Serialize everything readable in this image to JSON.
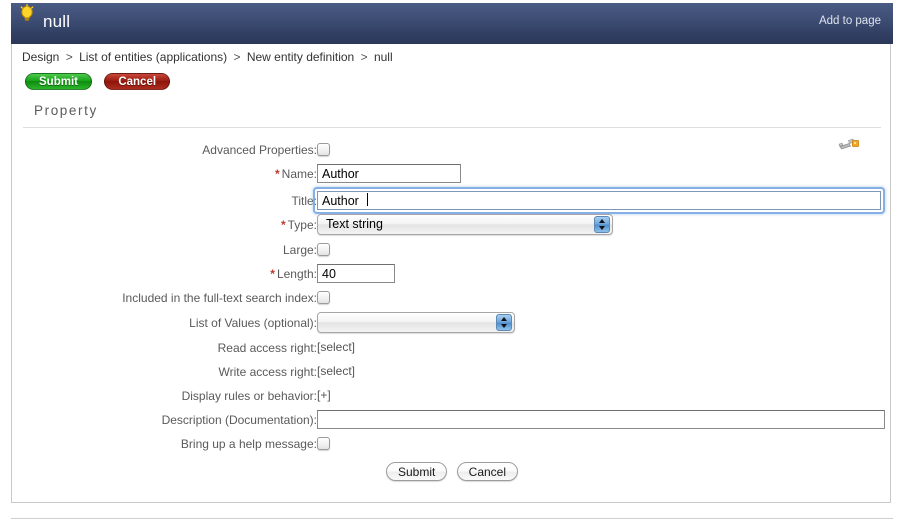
{
  "window": {
    "title": "null",
    "icon": "lightbulb-icon",
    "add_to_page_label": "Add to page",
    "header_color": "#3a4a72"
  },
  "breadcrumb": {
    "separator": ">",
    "items": [
      "Design",
      "List of entities (applications)",
      "New entity definition",
      "null"
    ]
  },
  "toolbar": {
    "submit_label": "Submit",
    "cancel_label": "Cancel",
    "submit_color": "#18a518",
    "cancel_color": "#9c1d12"
  },
  "section": {
    "title": "Property",
    "tool_icon": "wrench-icon"
  },
  "form": {
    "required_marker": "*",
    "rows": [
      {
        "label": "Advanced Properties:",
        "required": false,
        "type": "checkbox",
        "value": "",
        "checked": false
      },
      {
        "label": "Name:",
        "required": true,
        "type": "text",
        "value": "Author",
        "placeholder": ""
      },
      {
        "label": "Title:",
        "required": false,
        "type": "text",
        "value": "Author",
        "placeholder": "",
        "focused": true
      },
      {
        "label": "Type:",
        "required": true,
        "type": "select",
        "value": "Text string"
      },
      {
        "label": "Large:",
        "required": false,
        "type": "checkbox",
        "value": "",
        "checked": false
      },
      {
        "label": "Length:",
        "required": true,
        "type": "text",
        "value": "40",
        "placeholder": ""
      },
      {
        "label": "Included in the full-text search index:",
        "required": false,
        "type": "checkbox",
        "value": "",
        "checked": false
      },
      {
        "label": "List of Values (optional):",
        "required": false,
        "type": "select",
        "value": ""
      },
      {
        "label": "Read access right:",
        "required": false,
        "type": "plain",
        "value": "[select]"
      },
      {
        "label": "Write access right:",
        "required": false,
        "type": "plain",
        "value": "[select]"
      },
      {
        "label": "Display rules or behavior:",
        "required": false,
        "type": "plain",
        "value": "[+]"
      },
      {
        "label": "Description (Documentation):",
        "required": false,
        "type": "text",
        "value": "",
        "placeholder": ""
      },
      {
        "label": "Bring up a help message:",
        "required": false,
        "type": "checkbox",
        "value": "",
        "checked": false
      }
    ]
  },
  "footer": {
    "submit_label": "Submit",
    "cancel_label": "Cancel"
  }
}
